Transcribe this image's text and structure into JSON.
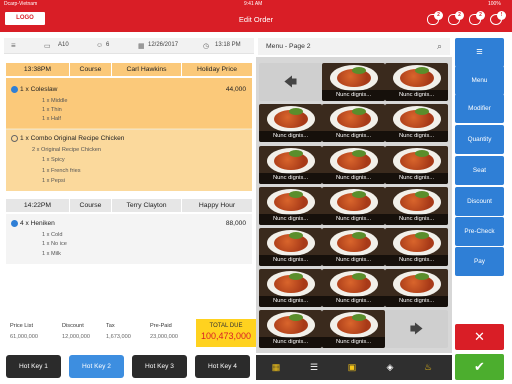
{
  "status": {
    "carrier": "Dcarp-Vietnam",
    "time": "9:41 AM",
    "battery": "100%"
  },
  "header": {
    "logo": "LOGO",
    "title": "Edit Order",
    "icons": [
      {
        "name": "notification-icon",
        "badge": "2"
      },
      {
        "name": "pending-orders-icon",
        "badge": "2"
      },
      {
        "name": "kitchen-icon",
        "badge": "2"
      },
      {
        "name": "settings-icon",
        "badge": "!"
      }
    ]
  },
  "info": {
    "table": "A10",
    "guests": "6",
    "date": "12/26/2017",
    "time": "13:18 PM"
  },
  "groups": [
    {
      "headers": [
        "13:38PM",
        "Course",
        "Carl Hawkins",
        "Holiday Price"
      ],
      "items": [
        {
          "name": "1 x Coleslaw",
          "price": "44,000",
          "checked": true,
          "subs": [
            "1 x Middle",
            "1 x Thin",
            "1 x Half"
          ]
        },
        {
          "name": "1 x Combo Original Recipe Chicken",
          "price": "",
          "checked": false,
          "subs": [
            "2 x Original Recipe Chicken",
            "1 x Spicy",
            "1 x French fries",
            "1 x Pepsi"
          ]
        }
      ]
    },
    {
      "headers": [
        "14:22PM",
        "Course",
        "Terry Clayton",
        "Happy Hour"
      ],
      "items": [
        {
          "name": "4 x Heniken",
          "price": "88,000",
          "checked": true,
          "subs": [
            "1 x Cold",
            "1 x No ice",
            "1 x Milk"
          ]
        }
      ]
    }
  ],
  "totals": {
    "price_list": {
      "label": "Price List",
      "value": "61,000,000"
    },
    "discount": {
      "label": "Discount",
      "value": "12,000,000"
    },
    "tax": {
      "label": "Tax",
      "value": "1,673,000"
    },
    "prepaid": {
      "label": "Pre-Paid",
      "value": "23,000,000"
    },
    "total_due": {
      "label": "TOTAL DUE",
      "value": "100,473,000"
    }
  },
  "hotkeys": [
    "Hot Key 1",
    "Hot Key 2",
    "Hot Key 3",
    "Hot Key 4"
  ],
  "hotkey_active": 1,
  "menu": {
    "title": "Menu - Page 2",
    "item_caption": "Nunc dignis...",
    "back_glyph": "🡄",
    "next_glyph": "🡆"
  },
  "toolbar_icons": [
    "grid-view-icon",
    "list-view-icon",
    "image-view-icon",
    "fish-icon",
    "food-icon"
  ],
  "actions": [
    "≡",
    "Menu",
    "Modifier",
    "Quantity",
    "Seat",
    "Discount",
    "Pre-Check",
    "Pay"
  ],
  "buttons": {
    "close": "✕",
    "ok": "✔"
  },
  "colors": {
    "brand": "#d91e26",
    "accent": "#2f7fd6",
    "group1": "#fbc97a",
    "group2": "#f2f2f2",
    "ok": "#4cae2e",
    "due": "#ffd21f"
  }
}
